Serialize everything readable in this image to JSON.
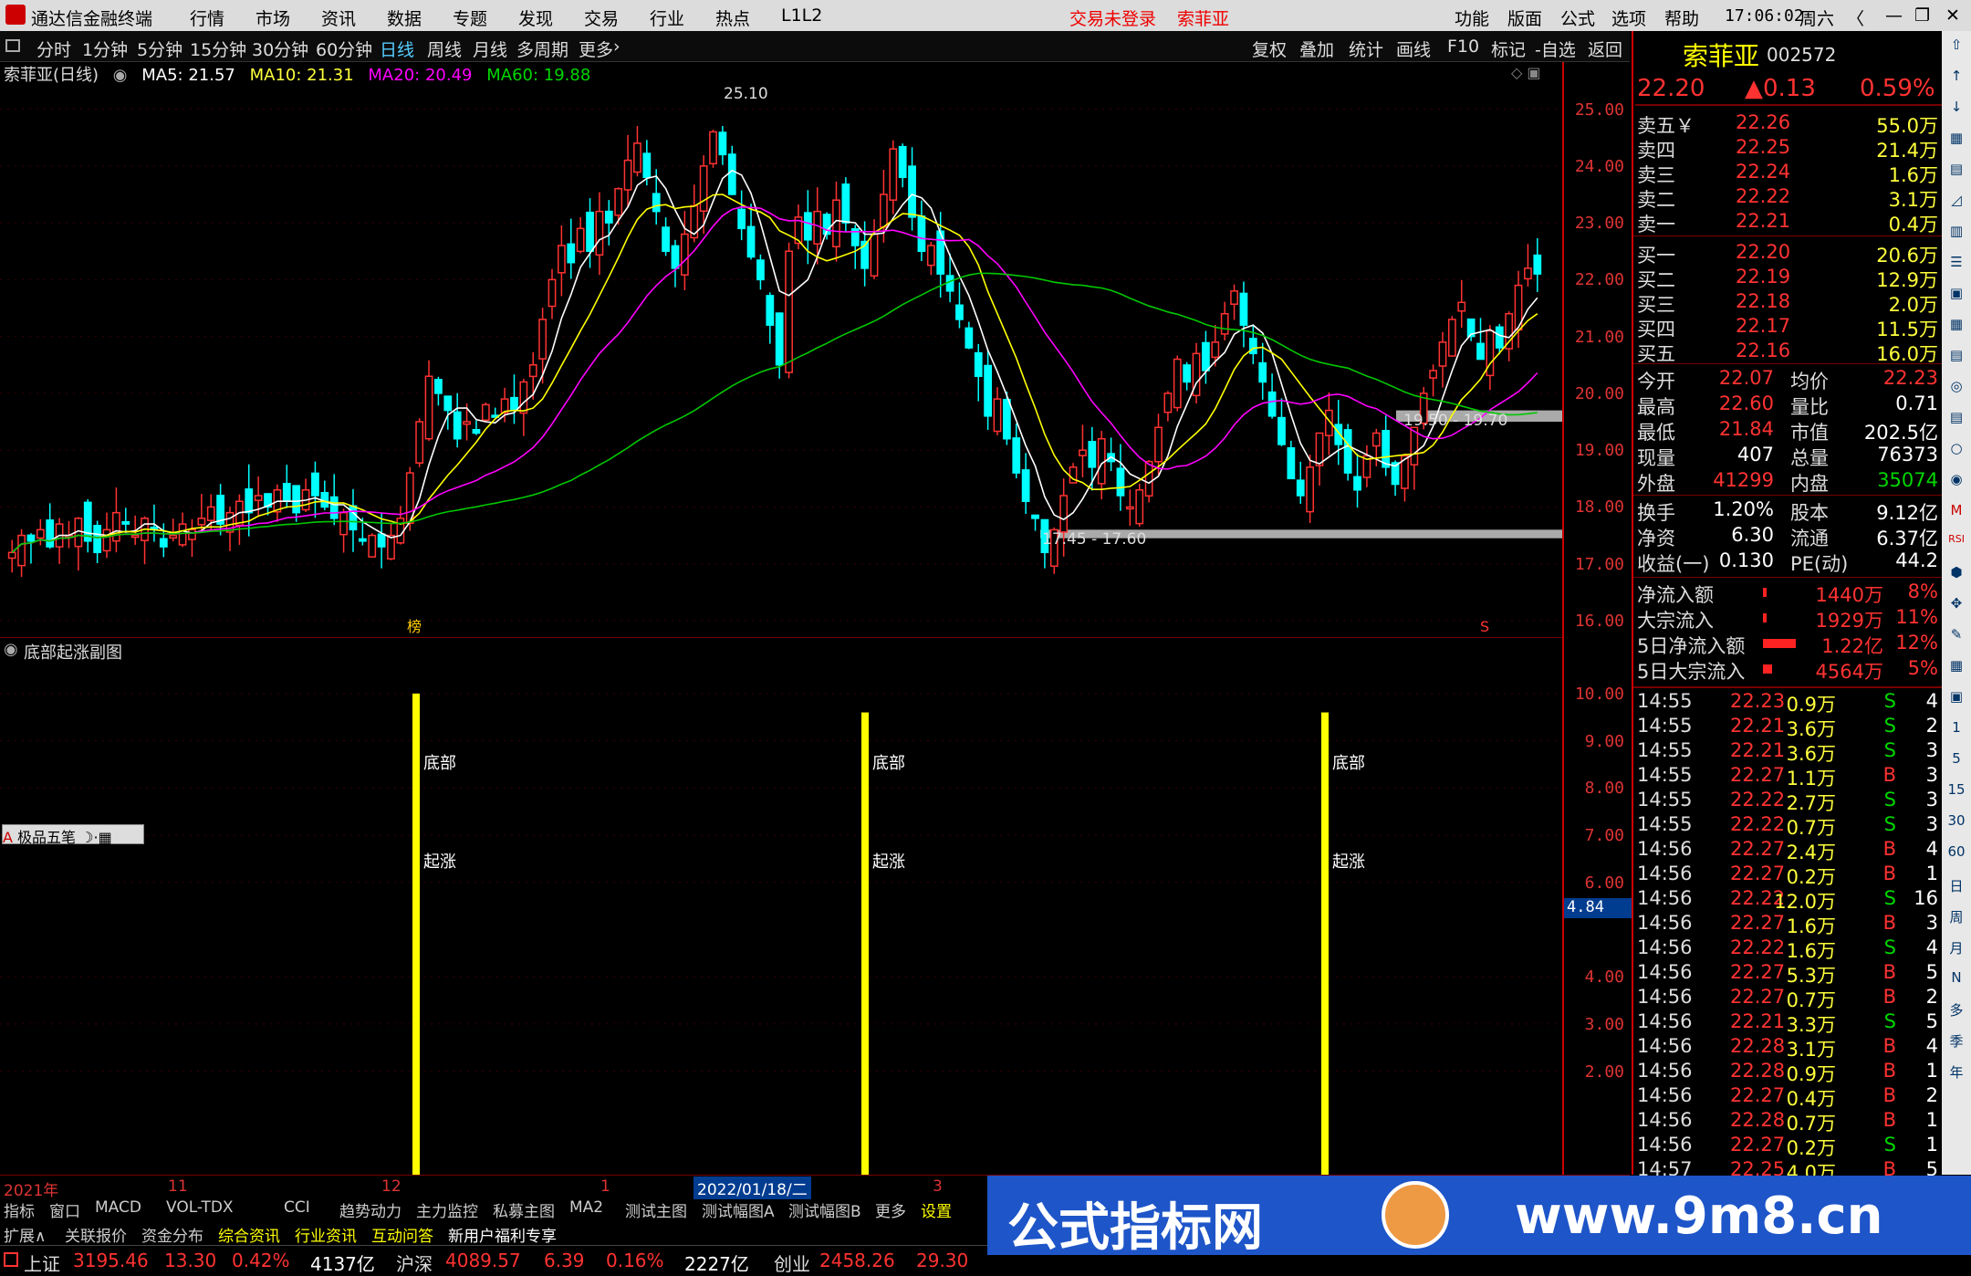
{
  "titlebar": {
    "app": "通达信金融终端",
    "menu": [
      "行情",
      "市场",
      "资讯",
      "数据",
      "专题",
      "发现",
      "交易",
      "行业",
      "热点",
      "L1L2"
    ],
    "login": "交易未登录",
    "stock": "索菲亚",
    "right_menu": [
      "功能",
      "版面",
      "公式",
      "选项",
      "帮助"
    ],
    "time": "17:06:02",
    "weekday": "周六"
  },
  "periodbar": {
    "items": [
      "分时",
      "1分钟",
      "5分钟",
      "15分钟",
      "30分钟",
      "60分钟",
      "日线",
      "周线",
      "月线",
      "多周期",
      "更多"
    ],
    "tools": [
      "复权",
      "叠加",
      "统计",
      "画线",
      "F10",
      "标记",
      "-自选",
      "返回"
    ]
  },
  "ma": {
    "name": "索菲亚(日线)",
    "ma5": "MA5: 21.57",
    "ma10": "MA10: 21.31",
    "ma20": "MA20: 20.49",
    "ma60": "MA60: 19.88"
  },
  "yaxis_main": [
    "25.00",
    "24.00",
    "23.00",
    "22.00",
    "21.00",
    "20.00",
    "19.00",
    "18.00",
    "17.00",
    "16.00"
  ],
  "yaxis_sub": [
    "10.00",
    "9.00",
    "8.00",
    "7.00",
    "6.00",
    "4.00",
    "3.00",
    "2.00"
  ],
  "sub_current": "4.84",
  "sub_title": "底部起涨副图",
  "signal_labels": {
    "top": "底部",
    "bottom": "起涨"
  },
  "annotations": {
    "high": "25.10",
    "low_band": "17.45 - 17.60",
    "mid_band": "19.50 - 19.70"
  },
  "markers": {
    "bang": "榜",
    "s": "S"
  },
  "toolbox": "极品五笔",
  "chart_data": {
    "type": "candlestick",
    "title": "索菲亚(日线)",
    "ylim": [
      16,
      25.3
    ],
    "price_high": 25.1,
    "support_bands": [
      [
        17.45,
        17.6
      ],
      [
        19.5,
        19.7
      ]
    ],
    "ma_values": {
      "MA5": 21.57,
      "MA10": 21.31,
      "MA20": 20.49,
      "MA60": 19.88
    },
    "colors": {
      "up": "#ff3232",
      "down": "#00ffff",
      "ma5": "#ffffff",
      "ma10": "#ffff00",
      "ma20": "#ff00ff",
      "ma60": "#00c800",
      "signal": "#ffff00"
    },
    "closes": [
      17.2,
      17.5,
      17.4,
      17.6,
      17.3,
      17.7,
      17.5,
      17.8,
      17.4,
      17.2,
      17.6,
      17.9,
      17.7,
      17.5,
      17.8,
      17.6,
      17.3,
      17.5,
      17.7,
      17.6,
      17.8,
      18.0,
      17.7,
      17.9,
      18.1,
      17.9,
      18.2,
      18.0,
      18.3,
      18.1,
      17.9,
      18.3,
      18.2,
      18.0,
      17.8,
      17.9,
      17.6,
      17.4,
      17.5,
      17.3,
      17.5,
      17.8,
      18.6,
      19.5,
      20.3,
      20.0,
      19.7,
      19.2,
      19.5,
      19.3,
      19.8,
      19.6,
      19.9,
      19.7,
      20.2,
      20.5,
      21.3,
      22.0,
      22.6,
      22.3,
      22.9,
      22.5,
      23.2,
      23.0,
      23.6,
      24.1,
      24.4,
      23.8,
      23.2,
      22.5,
      22.2,
      22.8,
      23.3,
      24.0,
      24.6,
      24.2,
      23.5,
      22.9,
      22.4,
      22.0,
      21.2,
      20.5,
      22.5,
      23.1,
      22.7,
      23.2,
      22.8,
      23.4,
      23.0,
      22.6,
      22.2,
      22.8,
      23.5,
      24.3,
      23.8,
      23.1,
      22.5,
      22.6,
      22.1,
      21.8,
      21.3,
      20.8,
      20.3,
      19.6,
      19.9,
      19.2,
      18.6,
      18.1,
      17.8,
      17.2,
      17.6,
      18.2,
      18.7,
      19.0,
      18.7,
      19.2,
      18.8,
      18.2,
      18.0,
      18.3,
      18.8,
      19.4,
      20.0,
      20.6,
      20.2,
      20.7,
      20.4,
      20.9,
      21.4,
      21.8,
      21.2,
      20.7,
      20.2,
      19.6,
      19.1,
      18.5,
      18.2,
      18.7,
      19.3,
      19.7,
      19.1,
      18.6,
      18.3,
      18.9,
      19.3,
      18.7,
      18.4,
      18.9,
      19.4,
      20.0,
      20.4,
      20.9,
      21.3,
      21.6,
      21.0,
      20.6,
      21.1,
      20.8,
      21.4,
      21.9,
      22.2,
      22.1
    ]
  },
  "signals": [
    {
      "date_label": "2021/11",
      "value": 10
    },
    {
      "date_label": "2022/01/18",
      "value": 9.6
    },
    {
      "date_label": "2022/04",
      "value": 9.6
    }
  ],
  "datebar": {
    "y2021": "2021年",
    "m11": "11",
    "m12": "12",
    "m1": "1",
    "sel": "2022/01/18/二",
    "m3": "3"
  },
  "tabs1": [
    "指标",
    "窗口",
    "MACD",
    "VOL-TDX",
    "CCI",
    "趋势动力",
    "主力监控",
    "私募主图",
    "MA2",
    "测试主图",
    "测试幅图A",
    "测试幅图B",
    "更多",
    "设置"
  ],
  "tabs2": [
    "扩展∧",
    "关联报价",
    "资金分布",
    "综合资讯",
    "行业资讯",
    "互动问答",
    "新用户福利专享"
  ],
  "status": {
    "sh_name": "上证",
    "sh_val": "3195.46",
    "sh_chg": "13.30",
    "sh_pct": "0.42%",
    "sh_amt": "4137亿",
    "hs_name": "沪深",
    "hs_val": "4089.57",
    "hs_chg": "6.39",
    "hs_pct": "0.16%",
    "hs_amt": "2227亿",
    "cy_name": "创业",
    "cy_val": "2458.26",
    "cy_chg": "29.30"
  },
  "quote": {
    "name": "索菲亚",
    "code": "002572",
    "price": "22.20",
    "change": "▲0.13",
    "pct": "0.59%",
    "asks": [
      [
        "卖五￥",
        "22.26",
        "55.0万"
      ],
      [
        "卖四",
        "22.25",
        "21.4万"
      ],
      [
        "卖三",
        "22.24",
        "1.6万"
      ],
      [
        "卖二",
        "22.22",
        "3.1万"
      ],
      [
        "卖一",
        "22.21",
        "0.4万"
      ]
    ],
    "bids": [
      [
        "买一",
        "22.20",
        "20.6万"
      ],
      [
        "买二",
        "22.19",
        "12.9万"
      ],
      [
        "买三",
        "22.18",
        "2.0万"
      ],
      [
        "买四",
        "22.17",
        "11.5万"
      ],
      [
        "买五",
        "22.16",
        "16.0万"
      ]
    ],
    "stats": [
      [
        "今开",
        "22.07",
        "均价",
        "22.23"
      ],
      [
        "最高",
        "22.60",
        "量比",
        "0.71"
      ],
      [
        "最低",
        "21.84",
        "市值",
        "202.5亿"
      ],
      [
        "现量",
        "407",
        "总量",
        "76373"
      ],
      [
        "外盘",
        "41299",
        "内盘",
        "35074"
      ]
    ],
    "stats2": [
      [
        "换手",
        "1.20%",
        "股本",
        "9.12亿"
      ],
      [
        "净资",
        "6.30",
        "流通",
        "6.37亿"
      ],
      [
        "收益(一)",
        "0.130",
        "PE(动)",
        "44.2"
      ]
    ],
    "flows": [
      [
        "净流入额",
        "1440万",
        "8%"
      ],
      [
        "大宗流入",
        "1929万",
        "11%"
      ],
      [
        "5日净流入额",
        "1.22亿",
        "12%"
      ],
      [
        "5日大宗流入",
        "4564万",
        "5%"
      ]
    ],
    "ticks": [
      [
        "14:55",
        "22.23",
        "0.9万",
        "S",
        "4"
      ],
      [
        "14:55",
        "22.21",
        "3.6万",
        "S",
        "2"
      ],
      [
        "14:55",
        "22.21",
        "3.6万",
        "S",
        "3"
      ],
      [
        "14:55",
        "22.27",
        "1.1万",
        "B",
        "3"
      ],
      [
        "14:55",
        "22.22",
        "2.7万",
        "S",
        "3"
      ],
      [
        "14:55",
        "22.22",
        "0.7万",
        "S",
        "3"
      ],
      [
        "14:56",
        "22.27",
        "2.4万",
        "B",
        "4"
      ],
      [
        "14:56",
        "22.27",
        "0.2万",
        "B",
        "1"
      ],
      [
        "14:56",
        "22.22",
        "12.0万",
        "S",
        "16"
      ],
      [
        "14:56",
        "22.27",
        "1.6万",
        "B",
        "3"
      ],
      [
        "14:56",
        "22.22",
        "1.6万",
        "S",
        "4"
      ],
      [
        "14:56",
        "22.27",
        "5.3万",
        "B",
        "5"
      ],
      [
        "14:56",
        "22.27",
        "0.7万",
        "B",
        "2"
      ],
      [
        "14:56",
        "22.21",
        "3.3万",
        "S",
        "5"
      ],
      [
        "14:56",
        "22.28",
        "3.1万",
        "B",
        "4"
      ],
      [
        "14:56",
        "22.28",
        "0.9万",
        "B",
        "1"
      ],
      [
        "14:56",
        "22.27",
        "0.4万",
        "B",
        "2"
      ],
      [
        "14:56",
        "22.28",
        "0.7万",
        "B",
        "1"
      ],
      [
        "14:56",
        "22.27",
        "0.2万",
        "S",
        "1"
      ],
      [
        "14:57",
        "22.25",
        "4.0万",
        "B",
        "5"
      ]
    ]
  },
  "righttool": [
    "日",
    "周",
    "月",
    "N",
    "多",
    "季",
    "年"
  ],
  "watermark": {
    "text": "公式指标网",
    "url": "www.9m8.cn"
  }
}
